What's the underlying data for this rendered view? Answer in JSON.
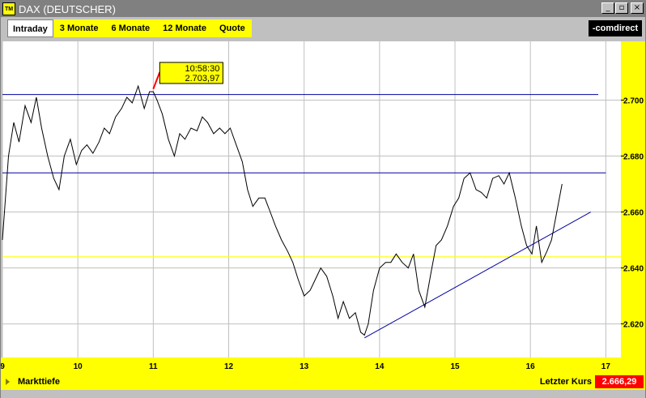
{
  "window": {
    "title": "DAX (DEUTSCHER)",
    "icon_label": "TM",
    "minimize": "_",
    "restore": "▫",
    "close": "×"
  },
  "tabs": [
    {
      "label": "Intraday",
      "active": true
    },
    {
      "label": "3 Monate",
      "active": false
    },
    {
      "label": "6 Monate",
      "active": false
    },
    {
      "label": "12 Monate",
      "active": false
    },
    {
      "label": "Quote",
      "active": false
    }
  ],
  "logo": "-comdirect",
  "footer": {
    "market_depth": "Markttiefe",
    "last_price_label": "Letzter Kurs",
    "last_price_value": "2.666,29"
  },
  "colors": {
    "plot_bg": "#ffffff",
    "axis_bg": "#ffff00",
    "grid": "#c0c0c0",
    "price_line": "#000000",
    "trend_lines": "#0000a0",
    "reference_line": "#ffff00",
    "tooltip_bg": "#ffff00"
  },
  "chart_data": {
    "type": "line",
    "x_ticks": [
      "9",
      "10",
      "11",
      "12",
      "13",
      "14",
      "15",
      "16",
      "17"
    ],
    "y_ticks": [
      "2.620",
      "2.640",
      "2.660",
      "2.680",
      "2.700"
    ],
    "xlim": [
      9,
      17.2
    ],
    "ylim": [
      2608,
      2721
    ],
    "grid": true,
    "tooltip": {
      "time": "10:58:30",
      "value": "2.703,97",
      "x": 11.0,
      "y": 2703.97
    },
    "reference_level": 2644,
    "horizontal_lines": [
      {
        "y": 2702,
        "x_start": 9.0,
        "x_end": 16.9
      },
      {
        "y": 2674,
        "x_start": 9.0,
        "x_end": 17.0
      }
    ],
    "trend_lines": [
      {
        "x1": 13.8,
        "y1": 2615,
        "x2": 16.8,
        "y2": 2660
      }
    ],
    "series": [
      {
        "x": [
          9.0,
          9.08,
          9.15,
          9.22,
          9.3,
          9.38,
          9.45,
          9.52,
          9.6,
          9.68,
          9.75,
          9.82,
          9.9,
          9.98,
          10.05,
          10.12,
          10.2,
          10.28,
          10.35,
          10.42,
          10.5,
          10.58,
          10.65,
          10.72,
          10.8,
          10.88,
          10.95,
          11.0,
          11.05,
          11.12,
          11.2,
          11.28,
          11.35,
          11.42,
          11.5,
          11.58,
          11.65,
          11.72,
          11.8,
          11.88,
          11.95,
          12.02,
          12.1,
          12.18,
          12.25,
          12.32,
          12.4,
          12.48,
          12.55,
          12.62,
          12.7,
          12.78,
          12.85,
          12.92,
          13.0,
          13.08,
          13.15,
          13.22,
          13.3,
          13.38,
          13.45,
          13.52,
          13.6,
          13.68,
          13.75,
          13.8,
          13.85,
          13.92,
          14.0,
          14.08,
          14.15,
          14.22,
          14.3,
          14.38,
          14.45,
          14.52,
          14.6,
          14.68,
          14.75,
          14.82,
          14.9,
          14.98,
          15.05,
          15.12,
          15.2,
          15.28,
          15.35,
          15.42,
          15.5,
          15.58,
          15.65,
          15.72,
          15.8,
          15.88,
          15.95,
          16.02,
          16.08,
          16.15,
          16.22,
          16.28,
          16.35,
          16.42
        ],
        "y": [
          2650,
          2680,
          2692,
          2685,
          2698,
          2692,
          2701,
          2690,
          2680,
          2672,
          2668,
          2680,
          2686,
          2677,
          2682,
          2684,
          2681,
          2685,
          2690,
          2688,
          2694,
          2697,
          2701,
          2699,
          2705,
          2697,
          2703,
          2703,
          2700,
          2695,
          2686,
          2680,
          2688,
          2686,
          2690,
          2689,
          2694,
          2692,
          2688,
          2690,
          2688,
          2690,
          2684,
          2678,
          2668,
          2662,
          2665,
          2665,
          2660,
          2655,
          2650,
          2646,
          2642,
          2636,
          2630,
          2632,
          2636,
          2640,
          2637,
          2630,
          2622,
          2628,
          2622,
          2624,
          2617,
          2616,
          2620,
          2632,
          2640,
          2642,
          2642,
          2645,
          2642,
          2640,
          2645,
          2632,
          2626,
          2638,
          2648,
          2650,
          2655,
          2662,
          2665,
          2672,
          2674,
          2668,
          2667,
          2665,
          2672,
          2673,
          2670,
          2674,
          2665,
          2655,
          2648,
          2645,
          2655,
          2642,
          2646,
          2650,
          2660,
          2670
        ]
      }
    ]
  }
}
